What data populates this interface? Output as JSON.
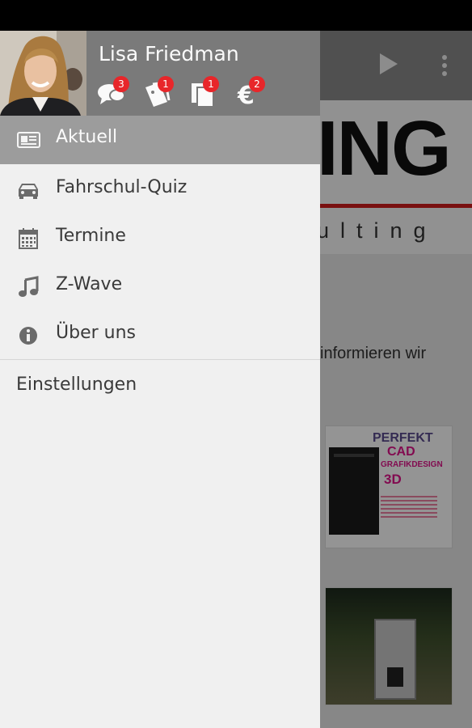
{
  "app": {
    "logo_text": "ING",
    "logo_subtitle": "ulting",
    "body_text": "informieren wir",
    "body_text_2": "...",
    "ad1": {
      "line1": "PERFEKT",
      "line2": "CAD",
      "line3": "GRAFIKDESIGN",
      "line4": "3D"
    }
  },
  "drawer": {
    "user_name": "Lisa Friedman",
    "header_icons": [
      {
        "icon": "chat-bubbles-icon",
        "badge": "3"
      },
      {
        "icon": "tickets-icon",
        "badge": "1"
      },
      {
        "icon": "documents-icon",
        "badge": "1"
      },
      {
        "icon": "euro-icon",
        "badge": "2"
      }
    ],
    "menu": [
      {
        "label": "Aktuell",
        "icon": "newspaper-icon",
        "active": true
      },
      {
        "label": "Fahrschul-Quiz",
        "icon": "car-icon",
        "active": false
      },
      {
        "label": "Termine",
        "icon": "calendar-icon",
        "active": false
      },
      {
        "label": "Z-Wave",
        "icon": "music-note-icon",
        "active": false
      },
      {
        "label": "Über uns",
        "icon": "info-icon",
        "active": false
      }
    ],
    "settings_label": "Einstellungen"
  },
  "colors": {
    "header_bg": "#7a7a7a",
    "active_item_bg": "#9c9c9c",
    "badge_red": "#e8262a",
    "logo_red": "#d01c1c"
  }
}
